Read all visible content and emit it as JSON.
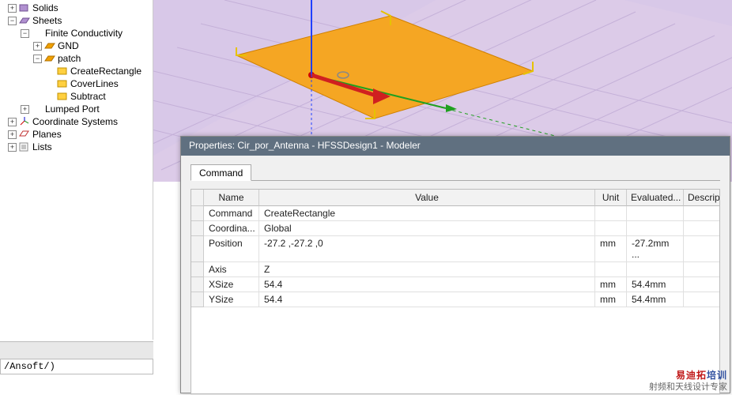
{
  "tree": {
    "solids": "Solids",
    "sheets": "Sheets",
    "finite": "Finite Conductivity",
    "gnd": "GND",
    "patch": "patch",
    "createRect": "CreateRectangle",
    "coverLines": "CoverLines",
    "subtract": "Subtract",
    "lumped": "Lumped Port",
    "coord": "Coordinate Systems",
    "planes": "Planes",
    "lists": "Lists"
  },
  "path": "/Ansoft/)",
  "dialog": {
    "title": "Properties: Cir_por_Antenna - HFSSDesign1 - Modeler",
    "tab": "Command",
    "headers": {
      "name": "Name",
      "value": "Value",
      "unit": "Unit",
      "evaluated": "Evaluated...",
      "description": "Description"
    },
    "rows": [
      {
        "name": "Command",
        "value": "CreateRectangle",
        "unit": "",
        "evaluated": ""
      },
      {
        "name": "Coordina...",
        "value": "Global",
        "unit": "",
        "evaluated": ""
      },
      {
        "name": "Position",
        "value": "-27.2 ,-27.2 ,0",
        "unit": "mm",
        "evaluated": "-27.2mm ..."
      },
      {
        "name": "Axis",
        "value": "Z",
        "unit": "",
        "evaluated": ""
      },
      {
        "name": "XSize",
        "value": "54.4",
        "unit": "mm",
        "evaluated": "54.4mm"
      },
      {
        "name": "YSize",
        "value": "54.4",
        "unit": "mm",
        "evaluated": "54.4mm"
      }
    ]
  },
  "watermark": {
    "main_red": "易迪拓",
    "main_blue": "培训",
    "sub": "射频和天线设计专家"
  }
}
